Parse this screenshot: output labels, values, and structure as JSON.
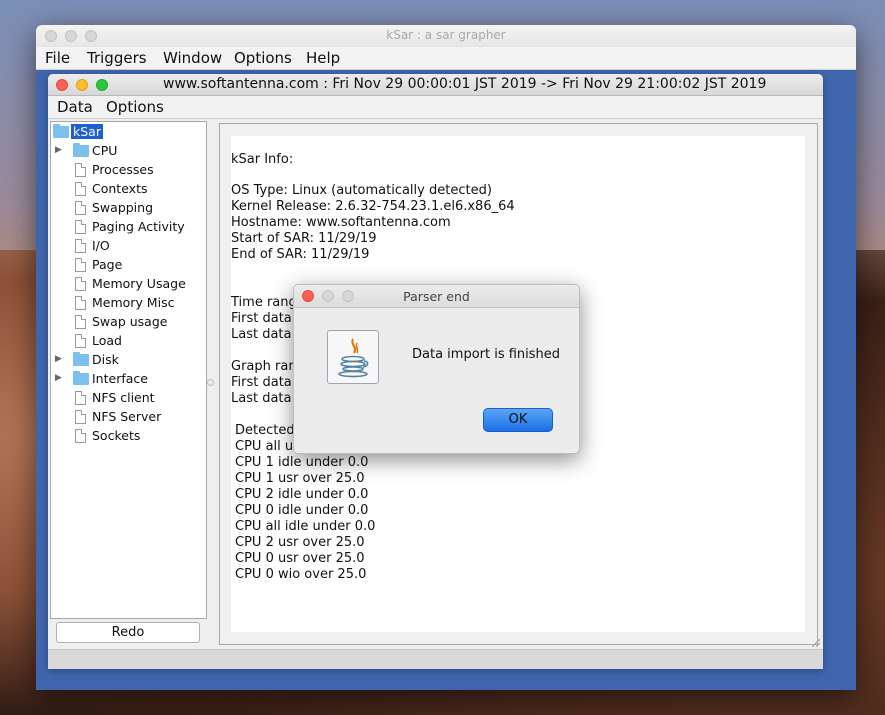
{
  "app": {
    "window_title": "kSar : a sar grapher",
    "menu": [
      "File",
      "Triggers",
      "Window",
      "Options",
      "Help"
    ]
  },
  "inner": {
    "window_title": "www.softantenna.com : Fri Nov 29 00:00:01 JST 2019 -> Fri Nov 29 21:00:02 JST 2019",
    "menu": [
      "Data",
      "Options"
    ]
  },
  "tree": {
    "root": "kSar",
    "items": [
      {
        "label": "CPU",
        "type": "folder",
        "expandable": true
      },
      {
        "label": "Processes",
        "type": "doc"
      },
      {
        "label": "Contexts",
        "type": "doc"
      },
      {
        "label": "Swapping",
        "type": "doc"
      },
      {
        "label": "Paging Activity",
        "type": "doc"
      },
      {
        "label": "I/O",
        "type": "doc"
      },
      {
        "label": "Page",
        "type": "doc"
      },
      {
        "label": "Memory Usage",
        "type": "doc"
      },
      {
        "label": "Memory Misc",
        "type": "doc"
      },
      {
        "label": "Swap usage",
        "type": "doc"
      },
      {
        "label": "Load",
        "type": "doc"
      },
      {
        "label": "Disk",
        "type": "folder",
        "expandable": true
      },
      {
        "label": "Interface",
        "type": "folder",
        "expandable": true
      },
      {
        "label": "NFS client",
        "type": "doc"
      },
      {
        "label": "NFS Server",
        "type": "doc"
      },
      {
        "label": "Sockets",
        "type": "doc"
      }
    ],
    "redo_label": "Redo"
  },
  "content": {
    "header": "kSar Info:",
    "info_lines": [
      "OS Type: Linux (automatically detected)",
      "Kernel Release: 2.6.32-754.23.1.el6.x86_64",
      "Hostname: www.softantenna.com",
      "Start of SAR: 11/29/19",
      "End of SAR: 11/29/19"
    ],
    "time_lines": [
      "Time rang",
      "First data",
      "Last data p"
    ],
    "graph_lines": [
      "Graph rang",
      "First data",
      "Last data p"
    ],
    "detected_lines": [
      "Detected",
      "CPU all usr over 25.0",
      "CPU 1 idle under 0.0",
      "CPU 1 usr over 25.0",
      "CPU 2 idle under 0.0",
      "CPU 0 idle under 0.0",
      "CPU all idle under 0.0",
      "CPU 2 usr over 25.0",
      "CPU 0 usr over 25.0",
      "CPU 0 wio over 25.0"
    ]
  },
  "dialog": {
    "title": "Parser end",
    "message": "Data import is finished",
    "ok_label": "OK",
    "icon": "java-icon"
  },
  "colors": {
    "accent": "#1f5fd6",
    "ok_button": "#2a7cf0",
    "folder": "#7cc0ee",
    "window_backdrop": "#3f66ad"
  }
}
